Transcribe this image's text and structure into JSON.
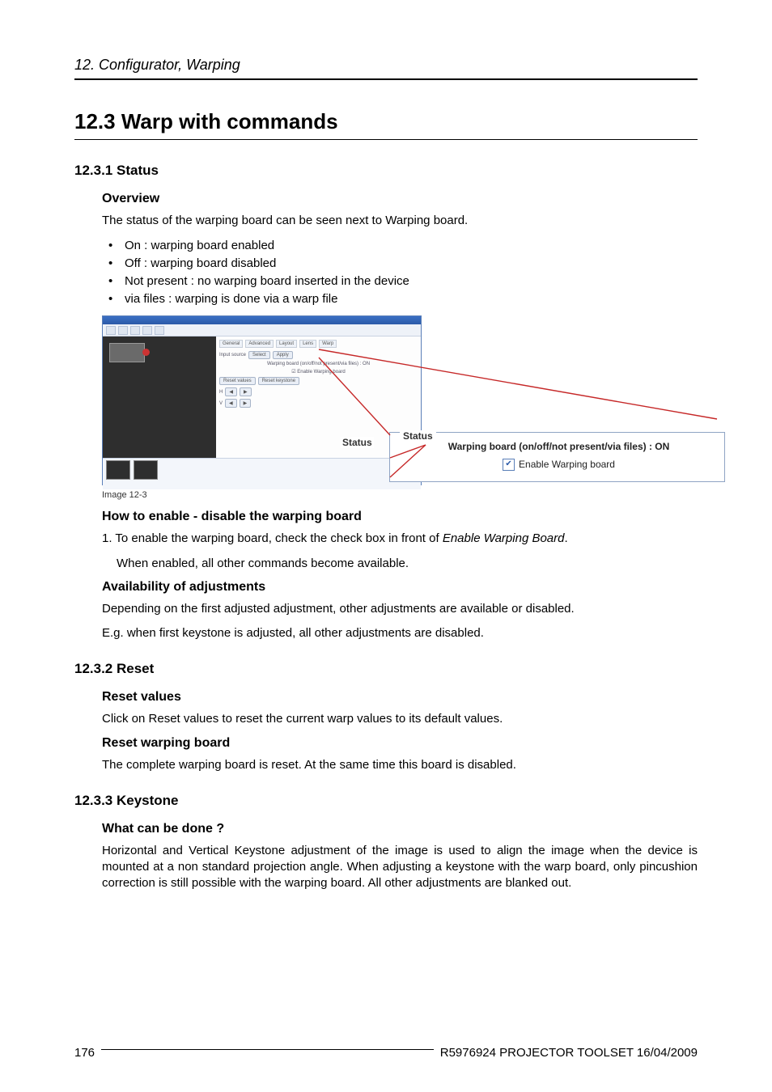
{
  "running_head": "12.  Configurator, Warping",
  "h1": "12.3  Warp with commands",
  "sections": {
    "s1": {
      "num_title": "12.3.1   Status",
      "overview_h": "Overview",
      "overview_p": "The status of the warping board can be seen next to Warping board.",
      "bullets": [
        "On :  warping board enabled",
        "Off :  warping board disabled",
        "Not present :  no warping board inserted in the device",
        "via files :  warping is done via a warp file"
      ],
      "caption": "Image 12-3",
      "howto_h": "How to enable - disable the warping board",
      "howto_step_pre": "1. To enable the warping board, check the check box in front of ",
      "howto_step_em": "Enable Warping Board",
      "howto_step_post": ".",
      "howto_step2": "When enabled, all other commands become available.",
      "avail_h": "Availability of adjustments",
      "avail_p1": "Depending on the first adjusted adjustment, other adjustments are available or disabled.",
      "avail_p2": "E.g.  when first keystone is adjusted, all other adjustments are disabled."
    },
    "s2": {
      "num_title": "12.3.2   Reset",
      "rv_h": "Reset values",
      "rv_p": "Click on Reset values to reset the current warp values to its default values.",
      "rwb_h": "Reset warping board",
      "rwb_p": "The complete warping board is reset.  At the same time this board is disabled."
    },
    "s3": {
      "num_title": "12.3.3   Keystone",
      "what_h": "What can be done ?",
      "what_p": "Horizontal and Vertical Keystone adjustment of the image is used to align the image when the device is mounted at a non standard projection angle.  When adjusting a keystone with the warp board, only pincushion correction is still possible with the warping board.  All other adjustments are blanked out."
    }
  },
  "figure": {
    "status_label": "Status",
    "detail_line": "Warping board (on/off/not present/via files) :  ON",
    "checkbox_label": "Enable Warping board"
  },
  "footer": {
    "page": "176",
    "doc": "R5976924   PROJECTOR TOOLSET   16/04/2009"
  },
  "chart_data": null
}
